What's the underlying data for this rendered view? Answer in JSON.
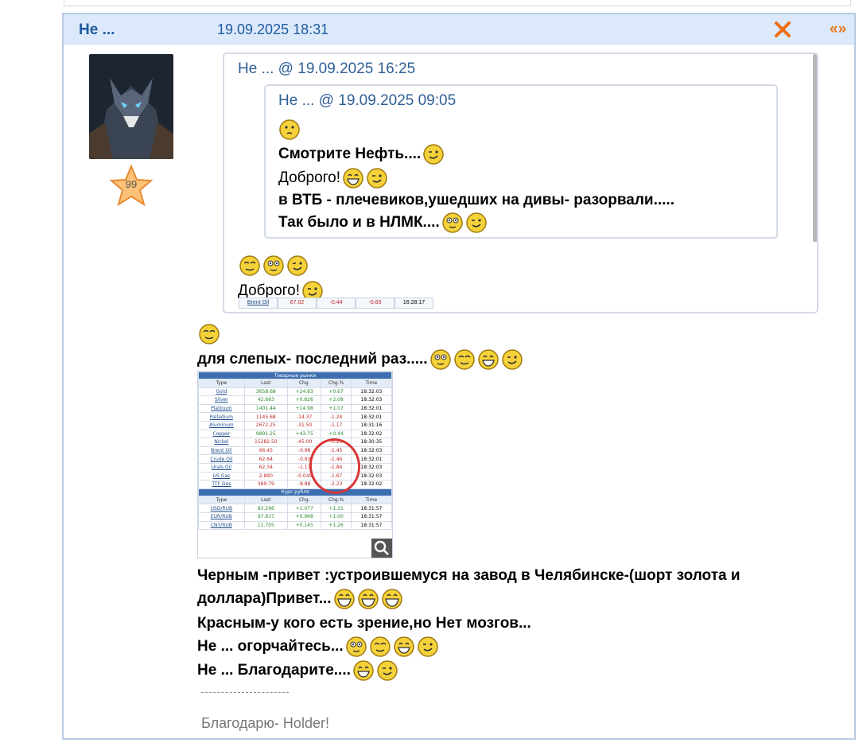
{
  "post": {
    "author": "Не ...",
    "date": "19.09.2025 18:31",
    "nav": "«»",
    "rating": "99"
  },
  "quote_outer": {
    "header": "Не ... @ 19.09.2025 16:25",
    "line_dobrogo": "Доброго!",
    "table_row": [
      "Brent Oil",
      "67.02",
      "-0.44",
      "-0.65",
      "16:28:17"
    ]
  },
  "quote_inner": {
    "header": "Не ... @ 19.09.2025 09:05",
    "lines": [
      "Смотрите Нефть....",
      "Доброго!",
      "в ВТБ - плечевиков,ушедших на дивы- разорвали.....",
      "Так было и в НЛМК...."
    ]
  },
  "body": {
    "line1": "для слепых- последний раз.....",
    "line2": "Черным -привет :устроившемуся на завод в Челябинске-(шорт золота и",
    "line3": "доллара)Привет...",
    "line4": "Красным-у кого есть зрение,но Нет мозгов...",
    "line5": "Не ... огорчайтесь...",
    "line6": "Не ... Благодарите...."
  },
  "screenshot_table": {
    "title": "Товарные рынки",
    "headers": [
      "Type",
      "Last",
      "Chg.",
      "Chg.%",
      "Time"
    ],
    "rows": [
      [
        "Gold",
        "3658.68",
        "+24.83",
        "+0.67",
        "18:32:03"
      ],
      [
        "Silver",
        "42.663",
        "+0.826",
        "+2.08",
        "18:32:03"
      ],
      [
        "Platinum",
        "1401.44",
        "+14.98",
        "+1.07",
        "18:32:01"
      ],
      [
        "Palladium",
        "1145.68",
        "-14.37",
        "-1.24",
        "18:32:01"
      ],
      [
        "Aluminum",
        "2672.25",
        "-31.50",
        "-1.17",
        "18:31:16"
      ],
      [
        "Copper",
        "9891.25",
        "+43.75",
        "+0.44",
        "18:32:02"
      ],
      [
        "Nickel",
        "15282.50",
        "-45.00",
        "-0.29",
        "18:30:35"
      ],
      [
        "Brent Oil",
        "66.45",
        "-0.98",
        "-1.45",
        "18:32:03"
      ],
      [
        "Crude Oil",
        "62.64",
        "-0.93",
        "-1.46",
        "18:32:01"
      ],
      [
        "Urals Oil",
        "62.34",
        "-1.17",
        "-1.84",
        "18:32:03"
      ],
      [
        "US Gas",
        "2.890",
        "-0.049",
        "-1.67",
        "18:32:03"
      ],
      [
        "TTF Gas",
        "389.79",
        "-8.88",
        "-2.23",
        "18:32:02"
      ]
    ],
    "title2": "Курс рубля",
    "rows2": [
      [
        "USD/RUB",
        "83.296",
        "+1.077",
        "+1.31",
        "18:31:57"
      ],
      [
        "EUR/RUB",
        "97.817",
        "+0.968",
        "+1.00",
        "18:31:57"
      ],
      [
        "CNY/RUB",
        "11.705",
        "+0.145",
        "+1.26",
        "18:31:57"
      ]
    ]
  },
  "signature": "Благодарю- Holder!"
}
